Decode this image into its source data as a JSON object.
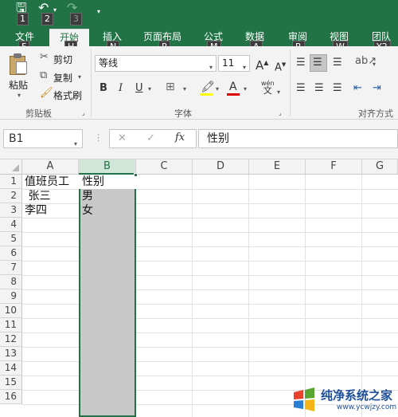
{
  "qat": {
    "save_keytip": "1",
    "undo_keytip": "2",
    "redo_keytip": "3"
  },
  "tabs": [
    {
      "label": "文件",
      "keytip": "F"
    },
    {
      "label": "开始",
      "keytip": "H"
    },
    {
      "label": "插入",
      "keytip": "N"
    },
    {
      "label": "页面布局",
      "keytip": "P"
    },
    {
      "label": "公式",
      "keytip": "M"
    },
    {
      "label": "数据",
      "keytip": "A"
    },
    {
      "label": "审阅",
      "keytip": "R"
    },
    {
      "label": "视图",
      "keytip": "W"
    },
    {
      "label": "团队",
      "keytip": "Y2"
    }
  ],
  "ribbon": {
    "paste_label": "粘贴",
    "cut_label": "剪切",
    "copy_label": "复制",
    "format_painter_label": "格式刷",
    "clipboard_group": "剪贴板",
    "font_name": "等线",
    "font_size": "11",
    "font_group": "字体",
    "align_group": "对齐方式",
    "bold": "B",
    "italic": "I",
    "underline": "U",
    "grow_font": "A",
    "shrink_font": "A",
    "font_color_letter": "A",
    "phonetic": "wén",
    "phonetic_char": "文"
  },
  "formula_bar": {
    "name_box": "B1",
    "formula": "性别"
  },
  "grid": {
    "columns": [
      "A",
      "B",
      "C",
      "D",
      "E",
      "F",
      "G"
    ],
    "selected_column": "B",
    "rows": [
      "1",
      "2",
      "3",
      "4",
      "5",
      "6",
      "7",
      "8",
      "9",
      "10",
      "11",
      "12",
      "13",
      "14",
      "15",
      "16"
    ],
    "cells": {
      "A1": "值班员工",
      "A2": " 张三",
      "A3": "李四",
      "B1": "性别",
      "B2": "男",
      "B3": "女"
    }
  },
  "watermark": {
    "name": "纯净系统之家",
    "url": "www.ycwjzy.com"
  },
  "colors": {
    "accent": "#217346",
    "selection_fill": "#c8c8c8"
  }
}
